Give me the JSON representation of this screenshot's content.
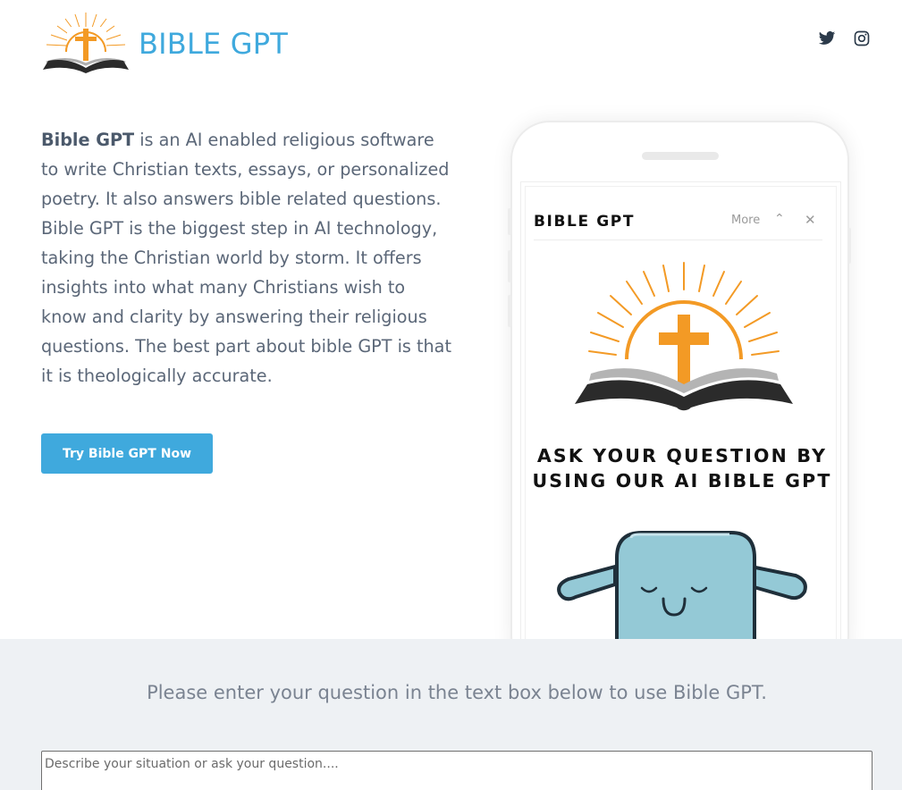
{
  "header": {
    "brand": "BIBLE GPT",
    "logo_icon": "bible-cross-sunrise-logo",
    "social": [
      {
        "name": "twitter-icon"
      },
      {
        "name": "instagram-icon"
      }
    ]
  },
  "intro": {
    "bold": "Bible GPT",
    "text": " is an AI enabled religious software to write Christian texts, essays, or personalized poetry. It also answers bible related questions. Bible GPT is the biggest step in AI technology, taking the Christian world by storm. It offers insights into what many Christians wish to know and clarity by answering their religious questions. The best part about bible GPT is that it is theologically accurate."
  },
  "cta": {
    "label": "Try Bible GPT Now"
  },
  "phone": {
    "app_title": "BIBLE GPT",
    "more": "More",
    "up": "⌃",
    "close": "✕",
    "heading_line1": "ASK YOUR QUESTION BY",
    "heading_line2": "USING OUR AI BIBLE GPT"
  },
  "question_section": {
    "prompt": "Please enter your question in the text box below to use Bible GPT.",
    "placeholder": "Describe your situation or ask your question...."
  },
  "colors": {
    "accent": "#3fa9dd",
    "cross": "#f39a25",
    "book": "#2b2b2b",
    "mascot": "#94c9d6",
    "lower_bg": "#eef1f4"
  }
}
